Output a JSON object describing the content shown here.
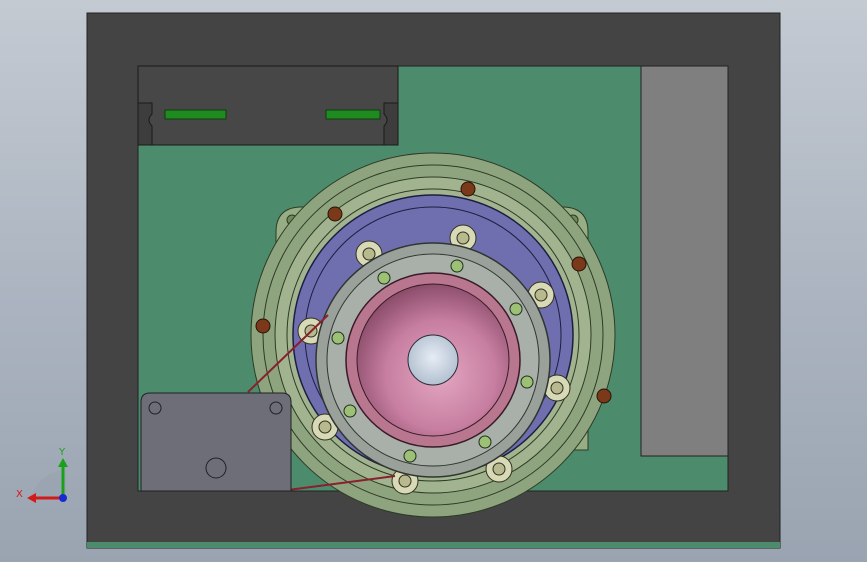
{
  "viewport": {
    "background_top": "#c4cad2",
    "background_bottom": "#9aa4b1"
  },
  "colors": {
    "housing": "#444444",
    "plate": "#4d8b6d",
    "driver_box": "#474747",
    "driver_slot": "#1f8a1f",
    "side_panel": "#7f7f7f",
    "flange": "#97ad84",
    "outer_ring": "#7f9d74",
    "bearing_race": "#6f6fb0",
    "hub": "#9aa19a",
    "cup": "#c77ea0",
    "bore": "#c9d3e0",
    "motor": "#6e6e78",
    "bolt": "#7a3a1a",
    "belt": "#8a1f2e"
  },
  "triad": {
    "x_label": "X",
    "y_label": "Y",
    "x_color": "#d11b1b",
    "y_color": "#1aa11a",
    "z_color": "#1a2ad1"
  }
}
